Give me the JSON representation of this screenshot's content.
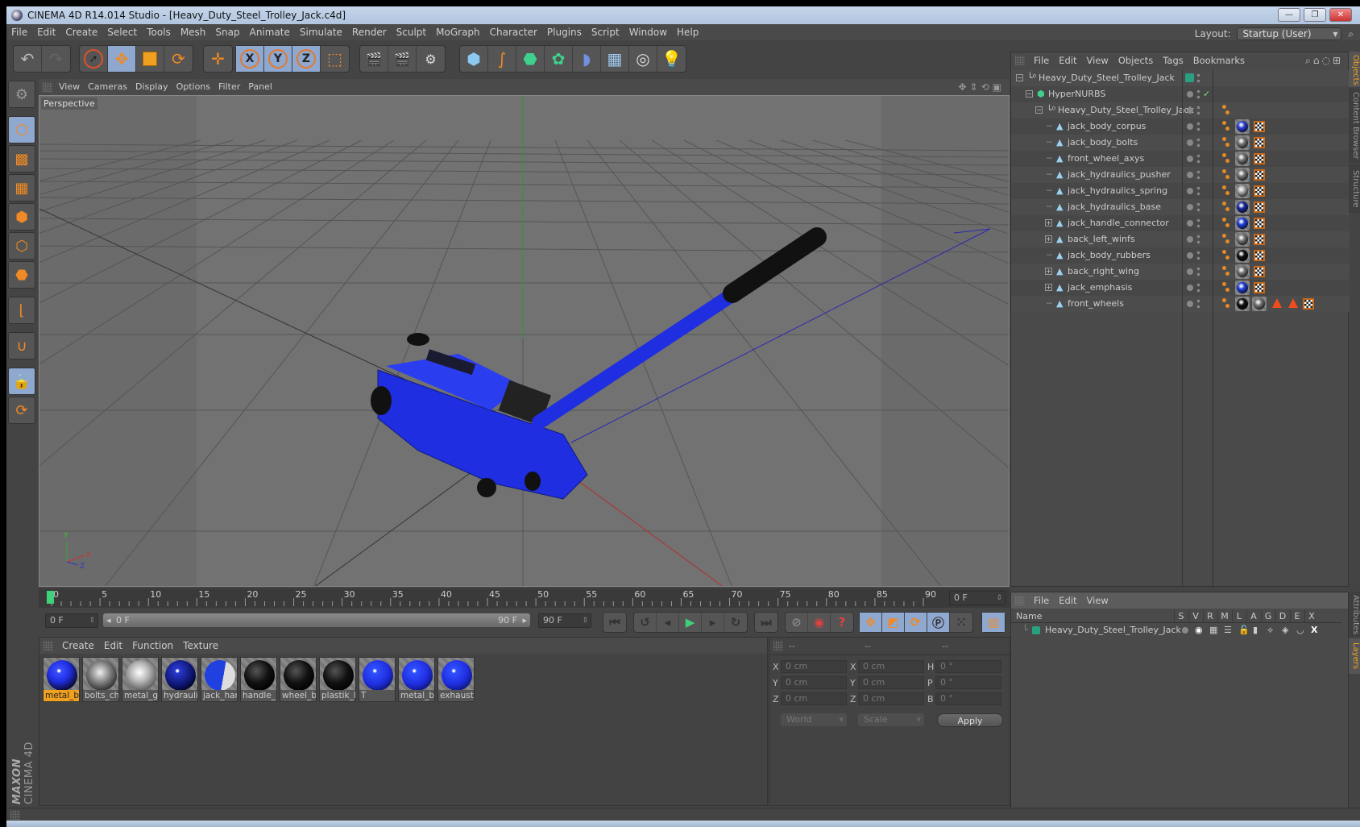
{
  "window": {
    "title": "CINEMA 4D R14.014 Studio - [Heavy_Duty_Steel_Trolley_Jack.c4d]",
    "controls": [
      "minimize",
      "restore",
      "close"
    ]
  },
  "menubar": {
    "items": [
      "File",
      "Edit",
      "Create",
      "Select",
      "Tools",
      "Mesh",
      "Snap",
      "Animate",
      "Simulate",
      "Render",
      "Sculpt",
      "MoGraph",
      "Character",
      "Plugins",
      "Script",
      "Window",
      "Help"
    ],
    "layout_label": "Layout:",
    "layout_value": "Startup (User)"
  },
  "toolbar": {
    "groups": [
      [
        "undo-icon",
        "redo-icon"
      ],
      [
        "live-selection-icon",
        "move-icon",
        "scale-icon",
        "rotate-icon"
      ],
      [
        "recent-tool-icon"
      ],
      [
        "x-axis-icon",
        "y-axis-icon",
        "z-axis-icon",
        "coordinate-system-icon"
      ],
      [
        "render-view-icon",
        "render-picture-viewer-icon",
        "render-settings-icon"
      ],
      [
        "cube-icon",
        "spline-pen-icon",
        "nurbs-icon",
        "array-icon",
        "deformer-icon",
        "floor-icon",
        "camera-icon",
        "light-icon"
      ]
    ],
    "axis_labels": [
      "X",
      "Y",
      "Z"
    ]
  },
  "left_tools": [
    "make-editable-icon",
    "model-mode-icon",
    "texture-mode-icon",
    "workplane-mode-icon",
    "points-mode-icon",
    "edges-mode-icon",
    "polygons-mode-icon",
    "axis-mode-icon",
    "magnet-icon",
    "workplane-lock-icon",
    "snap-workplane-icon"
  ],
  "logo": {
    "brand": "MAXON",
    "product": "CINEMA 4D"
  },
  "viewport": {
    "menu": [
      "View",
      "Cameras",
      "Display",
      "Options",
      "Filter",
      "Panel"
    ],
    "label": "Perspective",
    "nav_icons": [
      "pan-icon",
      "dolly-icon",
      "orbit-icon",
      "maximize-icon"
    ],
    "axis_gizmo": [
      "Y",
      "X",
      "Z"
    ]
  },
  "timeline": {
    "ticks": [
      "0",
      "5",
      "10",
      "15",
      "20",
      "25",
      "30",
      "35",
      "40",
      "45",
      "50",
      "55",
      "60",
      "65",
      "70",
      "75",
      "80",
      "85",
      "90"
    ],
    "current_frame": "0 F",
    "range_start": "0 F",
    "slider_start": "0 F",
    "slider_end": "90 F",
    "range_end": "90 F"
  },
  "playback": {
    "buttons": [
      "go-to-start-icon",
      "previous-key-icon",
      "previous-frame-icon",
      "play-icon",
      "next-frame-icon",
      "next-key-icon",
      "go-to-end-icon"
    ],
    "record_buttons": [
      "motion-record-icon",
      "autokey-icon",
      "keyframe-selection-icon"
    ],
    "key_buttons": [
      "position-key-icon",
      "scale-key-icon",
      "rotation-key-icon",
      "parameter-key-icon",
      "point-level-icon"
    ],
    "timeline_button": "timeline-icon"
  },
  "materials": {
    "menu": [
      "Create",
      "Edit",
      "Function",
      "Texture"
    ],
    "items": [
      {
        "name": "metal_b",
        "selected": true,
        "color": "#2a3fd8",
        "style": "blue-patch"
      },
      {
        "name": "bolts_ch",
        "selected": false,
        "color": "#888888",
        "style": "chrome"
      },
      {
        "name": "metal_g",
        "selected": false,
        "color": "#aaaaaa",
        "style": "silver"
      },
      {
        "name": "hydrauli",
        "selected": false,
        "color": "#1c2aa0",
        "style": "blue-dark"
      },
      {
        "name": "jack_har",
        "selected": false,
        "color": "#2040e0",
        "style": "blue-white"
      },
      {
        "name": "handle_",
        "selected": false,
        "color": "#111111",
        "style": "black"
      },
      {
        "name": "wheel_b",
        "selected": false,
        "color": "#111111",
        "style": "black"
      },
      {
        "name": "plastik_l",
        "selected": false,
        "color": "#0a0a0a",
        "style": "black"
      },
      {
        "name": "T",
        "selected": false,
        "color": "#2040e0",
        "style": "blue-stripe"
      },
      {
        "name": "metal_b",
        "selected": false,
        "color": "#2040e0",
        "style": "blue-stripe"
      },
      {
        "name": "exhaust",
        "selected": false,
        "color": "#2040e0",
        "style": "blue-stripe"
      }
    ]
  },
  "coordinates": {
    "headers": [
      "--",
      "--",
      "--"
    ],
    "rows": [
      {
        "l1": "X",
        "v1": "0 cm",
        "l2": "X",
        "v2": "0 cm",
        "l3": "H",
        "v3": "0 °"
      },
      {
        "l1": "Y",
        "v1": "0 cm",
        "l2": "Y",
        "v2": "0 cm",
        "l3": "P",
        "v3": "0 °"
      },
      {
        "l1": "Z",
        "v1": "0 cm",
        "l2": "Z",
        "v2": "0 cm",
        "l3": "B",
        "v3": "0 °"
      }
    ],
    "space_dropdown": "World",
    "mode_dropdown": "Scale",
    "apply_label": "Apply"
  },
  "objects": {
    "menu": [
      "File",
      "Edit",
      "View",
      "Objects",
      "Tags",
      "Bookmarks"
    ],
    "header_icons": [
      "search-icon",
      "home-icon",
      "eye-icon",
      "new-view-icon"
    ],
    "tree": [
      {
        "name": "Heavy_Duty_Steel_Trolley_Jack",
        "level": 0,
        "type": "null",
        "expand": "minus",
        "layer": true,
        "tags": []
      },
      {
        "name": "HyperNURBS",
        "level": 1,
        "type": "hypernurbs",
        "expand": "minus",
        "check": "✓",
        "tags": []
      },
      {
        "name": "Heavy_Duty_Steel_Trolley_Jack",
        "level": 2,
        "type": "null",
        "expand": "minus",
        "tags": [
          "phong"
        ]
      },
      {
        "name": "jack_body_corpus",
        "level": 3,
        "type": "poly",
        "tags": [
          "phong",
          "mat:#2a3fd8",
          "uv"
        ]
      },
      {
        "name": "jack_body_bolts",
        "level": 3,
        "type": "poly",
        "tags": [
          "phong",
          "mat:#777777",
          "uv"
        ]
      },
      {
        "name": "front_wheel_axys",
        "level": 3,
        "type": "poly",
        "tags": [
          "phong",
          "mat:#777777",
          "uv"
        ]
      },
      {
        "name": "jack_hydraulics_pusher",
        "level": 3,
        "type": "poly",
        "tags": [
          "phong",
          "mat:#777777",
          "uv"
        ]
      },
      {
        "name": "jack_hydraulics_spring",
        "level": 3,
        "type": "poly",
        "tags": [
          "phong",
          "mat:#aaaaaa",
          "uv"
        ]
      },
      {
        "name": "jack_hydraulics_base",
        "level": 3,
        "type": "poly",
        "tags": [
          "phong",
          "mat:#1c2aa0",
          "uv"
        ]
      },
      {
        "name": "jack_handle_connector",
        "level": 3,
        "type": "poly",
        "expand": "plus",
        "tags": [
          "phong",
          "mat:#2040e0",
          "uv"
        ]
      },
      {
        "name": "back_left_winfs",
        "level": 3,
        "type": "poly",
        "expand": "plus",
        "tags": [
          "phong",
          "mat:#777777",
          "uv"
        ]
      },
      {
        "name": "jack_body_rubbers",
        "level": 3,
        "type": "poly",
        "tags": [
          "phong",
          "mat:#111111",
          "uv"
        ]
      },
      {
        "name": "back_right_wing",
        "level": 3,
        "type": "poly",
        "expand": "plus",
        "tags": [
          "phong",
          "mat:#777777",
          "uv"
        ]
      },
      {
        "name": "jack_emphasis",
        "level": 3,
        "type": "poly",
        "expand": "plus",
        "tags": [
          "phong",
          "mat:#2040e0",
          "uv"
        ]
      },
      {
        "name": "front_wheels",
        "level": 3,
        "type": "poly",
        "tags": [
          "phong",
          "mat:#111111",
          "mat:#777777",
          "tri",
          "tri",
          "uv"
        ]
      }
    ]
  },
  "layers": {
    "menu": [
      "File",
      "Edit",
      "View"
    ],
    "columns": [
      "Name",
      "S",
      "V",
      "R",
      "M",
      "L",
      "A",
      "G",
      "D",
      "E",
      "X"
    ],
    "rows": [
      {
        "name": "Heavy_Duty_Steel_Trolley_Jack",
        "color": "#2aa080"
      }
    ]
  },
  "side_tabs": {
    "top": [
      {
        "label": "Objects",
        "active": true
      },
      {
        "label": "Content Browser",
        "active": false
      },
      {
        "label": "Structure",
        "active": false
      }
    ],
    "bottom": [
      {
        "label": "Attributes",
        "active": false
      },
      {
        "label": "Layers",
        "active": true
      }
    ]
  },
  "colors": {
    "accent_orange": "#f08a24",
    "active_blue": "#8fa8d0",
    "selected_material": "#f0a020",
    "jack_blue": "#1f2ee0"
  }
}
